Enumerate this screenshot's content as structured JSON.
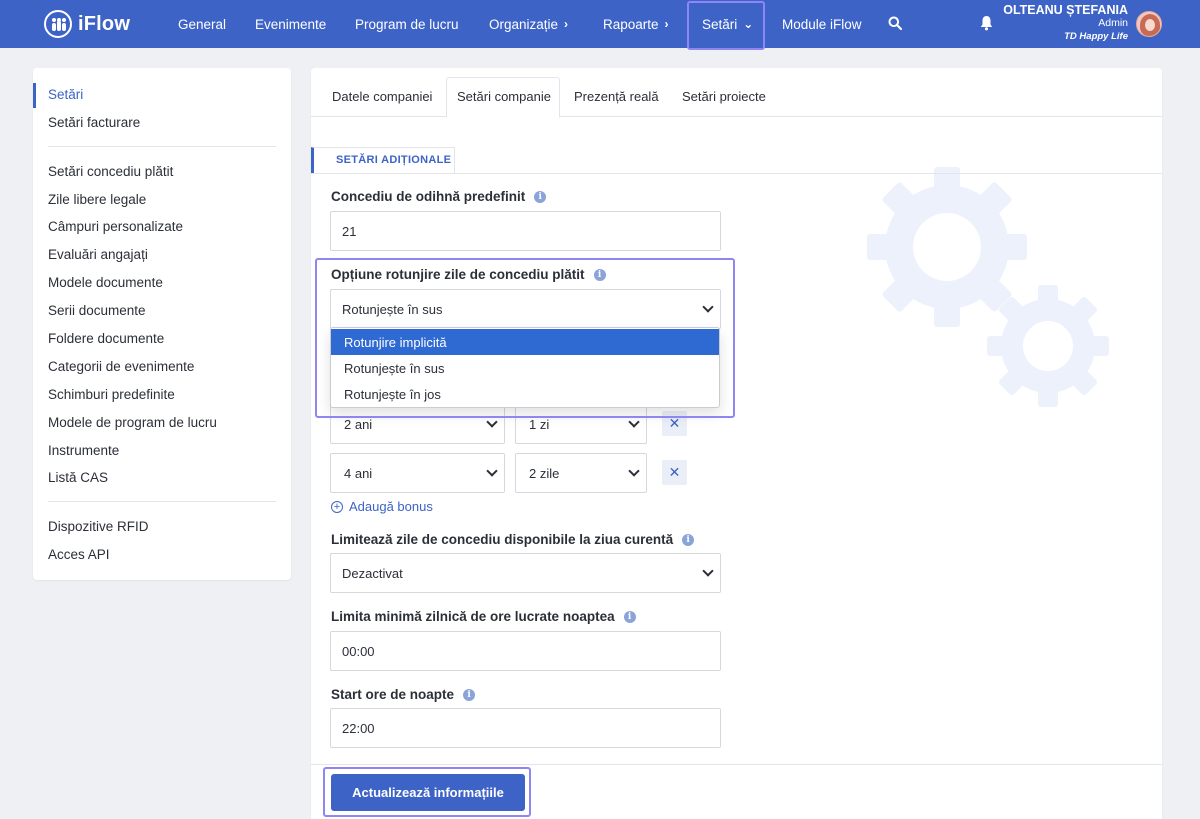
{
  "app": {
    "name": "iFlow"
  },
  "nav": {
    "items": [
      {
        "label": "General"
      },
      {
        "label": "Evenimente"
      },
      {
        "label": "Program de lucru"
      },
      {
        "label": "Organizație"
      },
      {
        "label": "Rapoarte"
      },
      {
        "label": "Setări"
      },
      {
        "label": "Module iFlow"
      }
    ],
    "active": "Setări"
  },
  "user": {
    "name": "OLTEANU ȘTEFANIA",
    "role": "Admin",
    "company": "TD Happy Life"
  },
  "sidebar": {
    "items": [
      {
        "label": "Setări"
      },
      {
        "label": "Setări facturare"
      },
      {
        "label": "Setări concediu plătit"
      },
      {
        "label": "Zile libere legale"
      },
      {
        "label": "Câmpuri personalizate"
      },
      {
        "label": "Evaluări angajați"
      },
      {
        "label": "Modele documente"
      },
      {
        "label": "Serii documente"
      },
      {
        "label": "Foldere documente"
      },
      {
        "label": "Categorii de evenimente"
      },
      {
        "label": "Schimburi predefinite"
      },
      {
        "label": "Modele de program de lucru"
      },
      {
        "label": "Instrumente"
      },
      {
        "label": "Listă CAS"
      },
      {
        "label": "Dispozitive RFID"
      },
      {
        "label": "Acces API"
      }
    ],
    "active": "Setări"
  },
  "tabs": [
    {
      "label": "Datele companiei"
    },
    {
      "label": "Setări companie"
    },
    {
      "label": "Prezență reală"
    },
    {
      "label": "Setări proiecte"
    }
  ],
  "active_tab": "Setări companie",
  "section": {
    "title": "SETĂRI ADIȚIONALE"
  },
  "form": {
    "default_leave": {
      "label": "Concediu de odihnă predefinit",
      "value": "21"
    },
    "rounding": {
      "label": "Opțiune rotunjire zile de concediu plătit",
      "value": "Rotunjește în sus",
      "options": [
        "Rotunjire implicită",
        "Rotunjește în sus",
        "Rotunjește în jos"
      ],
      "highlighted": "Rotunjire implicită"
    },
    "bonus_rows": [
      {
        "years": "2 ani",
        "days": "1 zi"
      },
      {
        "years": "4 ani",
        "days": "2 zile"
      }
    ],
    "remove_label": "✕",
    "add_bonus": "Adaugă bonus",
    "limit_current_day": {
      "label": "Limitează zile de concediu disponibile la ziua curentă",
      "value": "Dezactivat"
    },
    "min_night_hours": {
      "label": "Limita minimă zilnică de ore lucrate noaptea",
      "value": "00:00"
    },
    "night_start": {
      "label": "Start ore de noapte",
      "value": "22:00"
    }
  },
  "submit": {
    "label": "Actualizează informațiile"
  },
  "colors": {
    "brand": "#3d63c6",
    "highlight": "#8f86f3",
    "selected_option": "#2f69d2"
  }
}
